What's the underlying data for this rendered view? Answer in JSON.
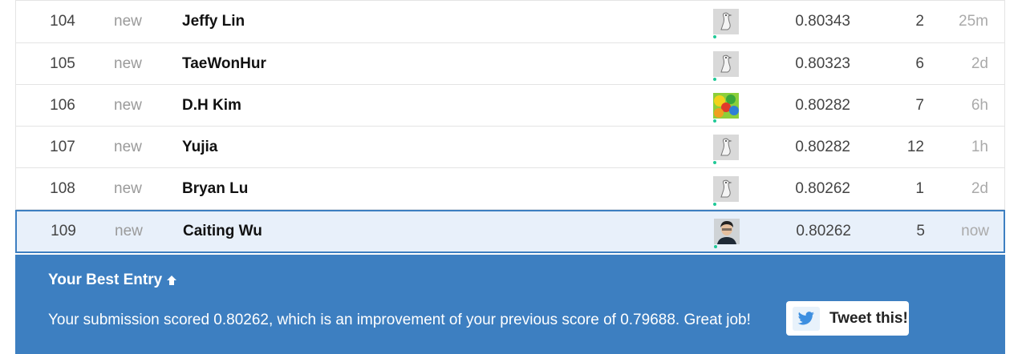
{
  "leaderboard": {
    "rows": [
      {
        "rank": "104",
        "change": "new",
        "team": "Jeffy Lin",
        "avatar": "goose-avatar",
        "score": "0.80343",
        "entries": "2",
        "last": "25m"
      },
      {
        "rank": "105",
        "change": "new",
        "team": "TaeWonHur",
        "avatar": "goose-avatar",
        "score": "0.80323",
        "entries": "6",
        "last": "2d"
      },
      {
        "rank": "106",
        "change": "new",
        "team": "D.H Kim",
        "avatar": "colorful-avatar",
        "score": "0.80282",
        "entries": "7",
        "last": "6h"
      },
      {
        "rank": "107",
        "change": "new",
        "team": "Yujia",
        "avatar": "goose-avatar",
        "score": "0.80282",
        "entries": "12",
        "last": "1h"
      },
      {
        "rank": "108",
        "change": "new",
        "team": "Bryan Lu",
        "avatar": "goose-avatar",
        "score": "0.80262",
        "entries": "1",
        "last": "2d"
      },
      {
        "rank": "109",
        "change": "new",
        "team": "Caiting Wu",
        "avatar": "person-avatar",
        "score": "0.80262",
        "entries": "5",
        "last": "now",
        "highlighted": true
      }
    ]
  },
  "best_entry": {
    "title": "Your Best Entry",
    "message": "Your submission scored 0.80262, which is an improvement of your previous score of 0.79688. Great job!",
    "tweet_label": "Tweet this!",
    "colors": {
      "panel": "#3d7fc1",
      "status_dot": "#20c997"
    }
  }
}
